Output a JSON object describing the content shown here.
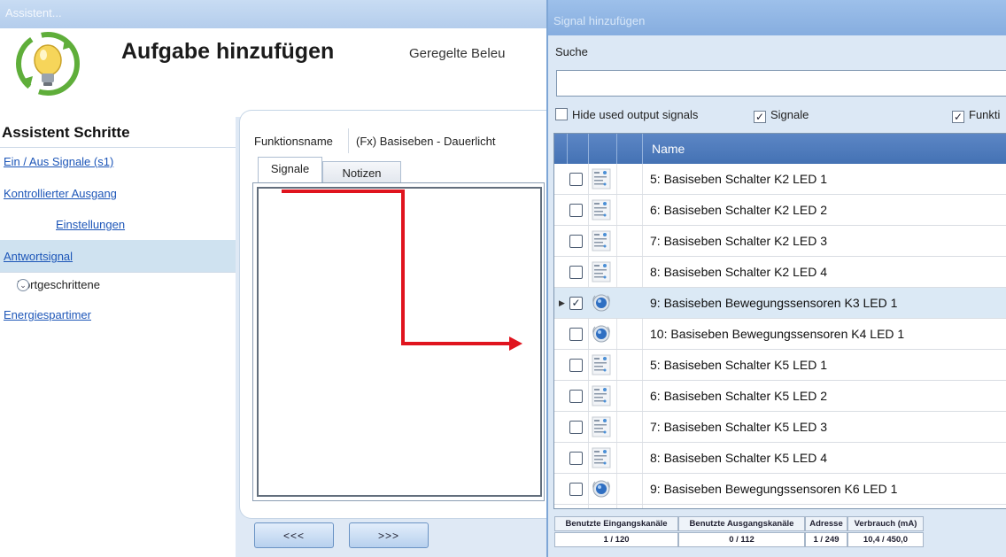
{
  "assistant": {
    "window_title": "Assistent...",
    "page_title": "Aufgabe hinzufügen",
    "subtitle": "Geregelte Beleu",
    "steps_title": "Assistent Schritte",
    "steps": {
      "on_off": "Ein / Aus Signale (s1)",
      "controlled_output": "Kontrollierter Ausgang",
      "settings": "Einstellungen",
      "response_signal": "Antwortsignal",
      "advanced": "Fortgeschrittene",
      "energy_timer": "Energiespartimer"
    },
    "function_label": "Funktionsname",
    "function_value": "(Fx) Basiseben - Dauerlicht",
    "tabs": {
      "signals": "Signale",
      "notes": "Notizen"
    },
    "nav": {
      "back": "<<<",
      "next": ">>>"
    }
  },
  "signal_dialog": {
    "title": "Signal hinzufügen",
    "search_label": "Suche",
    "search_value": "",
    "options": {
      "hide_used": "Hide used output signals",
      "hide_used_checked": false,
      "signals": "Signale",
      "signals_checked": true,
      "functions": "Funkti",
      "functions_checked": true
    },
    "column_name": "Name",
    "rows": [
      {
        "name": "5: Basiseben Schalter K2 LED 1",
        "checked": false,
        "icon": "switch-icon",
        "selected": false
      },
      {
        "name": "6: Basiseben Schalter K2 LED 2",
        "checked": false,
        "icon": "switch-icon",
        "selected": false
      },
      {
        "name": "7: Basiseben Schalter K2 LED 3",
        "checked": false,
        "icon": "switch-icon",
        "selected": false
      },
      {
        "name": "8: Basiseben Schalter K2 LED 4",
        "checked": false,
        "icon": "switch-icon",
        "selected": false
      },
      {
        "name": "9: Basiseben Bewegungssensoren K3 LED 1",
        "checked": true,
        "icon": "motion-sensor-icon",
        "selected": true
      },
      {
        "name": "10: Basiseben Bewegungssensoren K4 LED 1",
        "checked": false,
        "icon": "motion-sensor-icon",
        "selected": false
      },
      {
        "name": "5: Basiseben Schalter K5 LED 1",
        "checked": false,
        "icon": "switch-icon",
        "selected": false
      },
      {
        "name": "6: Basiseben Schalter K5 LED 2",
        "checked": false,
        "icon": "switch-icon",
        "selected": false
      },
      {
        "name": "7: Basiseben Schalter K5 LED 3",
        "checked": false,
        "icon": "switch-icon",
        "selected": false
      },
      {
        "name": "8: Basiseben Schalter K5 LED 4",
        "checked": false,
        "icon": "switch-icon",
        "selected": false
      },
      {
        "name": "9: Basiseben Bewegungssensoren K6 LED 1",
        "checked": false,
        "icon": "motion-sensor-icon",
        "selected": false
      }
    ],
    "stats": {
      "input_label": "Benutzte Eingangskanäle",
      "input_value": "1 / 120",
      "output_label": "Benutzte Ausgangskanäle",
      "output_value": "0 / 112",
      "address_label": "Adresse",
      "address_value": "1 / 249",
      "consumption_label": "Verbrauch (mA)",
      "consumption_value": "10,4 / 450,0"
    }
  },
  "colors": {
    "header_blue": "#4472b4",
    "link_blue": "#1d56b8",
    "arrow_red": "#e0141e",
    "selected_row": "#dbe9f5"
  }
}
